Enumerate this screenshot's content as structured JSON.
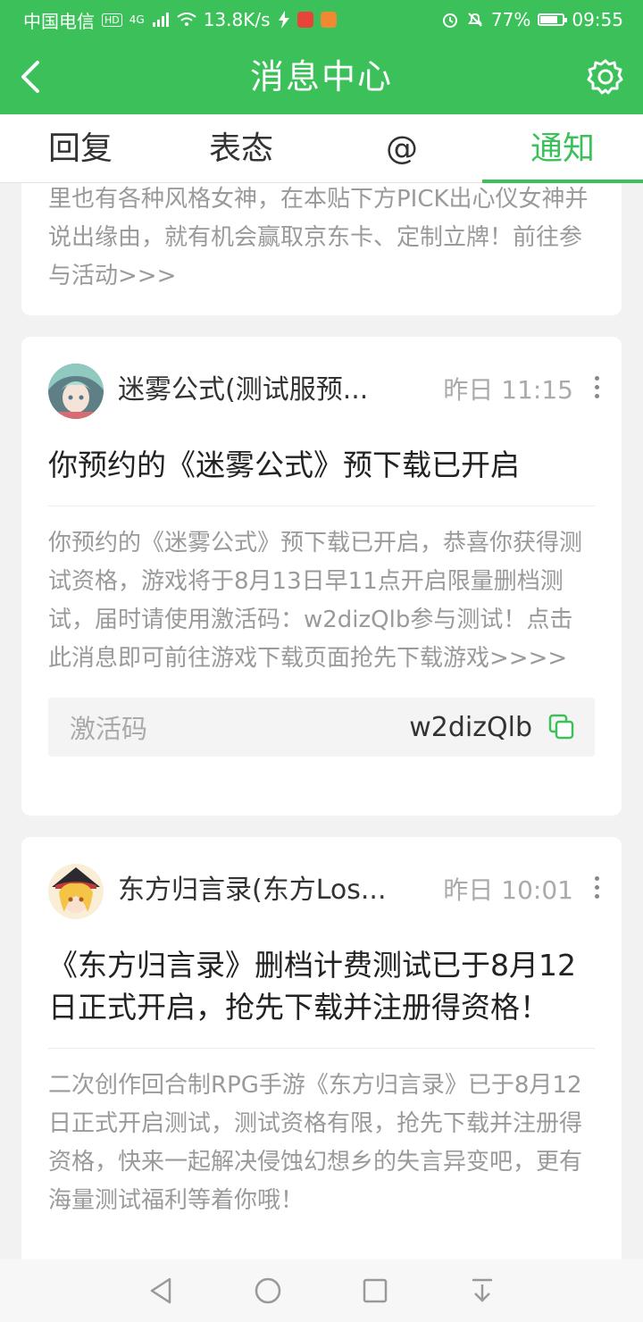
{
  "status_bar": {
    "carrier": "中国电信",
    "hd": "HD",
    "network": "4G",
    "speed": "13.8K/s",
    "battery": "77%",
    "time": "09:55"
  },
  "header": {
    "title": "消息中心",
    "back_icon": "chevron-left-icon",
    "settings_icon": "gear-icon"
  },
  "tabs": [
    {
      "label": "回复",
      "active": false
    },
    {
      "label": "表态",
      "active": false
    },
    {
      "label": "@",
      "active": false
    },
    {
      "label": "通知",
      "active": true
    }
  ],
  "partial_card": {
    "body": "里也有各种风格女神，在本贴下方PICK出心仪女神并说出缘由，就有机会赢取京东卡、定制立牌！前往参与活动>>>"
  },
  "notifications": [
    {
      "sender": "迷雾公式(测试服预...",
      "time": "昨日 11:15",
      "title": "你预约的《迷雾公式》预下载已开启",
      "body": "你预约的《迷雾公式》预下载已开启，恭喜你获得测试资格，游戏将于8月13日早11点开启限量删档测试，届时请使用激活码：w2dizQlb参与测试！点击此消息即可前往游戏下载页面抢先下载游戏>>>>",
      "code_label": "激活码",
      "code_value": "w2dizQlb"
    },
    {
      "sender": "东方归言录(东方Los...",
      "time": "昨日 10:01",
      "title": "《东方归言录》删档计费测试已于8月12日正式开启，抢先下载并注册得资格！",
      "body": "二次创作回合制RPG手游《东方归言录》已于8月12日正式开启测试，测试资格有限，抢先下载并注册得资格，快来一起解决侵蚀幻想乡的失言异变吧，更有海量测试福利等着你哦！"
    }
  ],
  "colors": {
    "accent": "#3cc15a",
    "text_primary": "#222222",
    "text_secondary": "#9a9a9a"
  }
}
